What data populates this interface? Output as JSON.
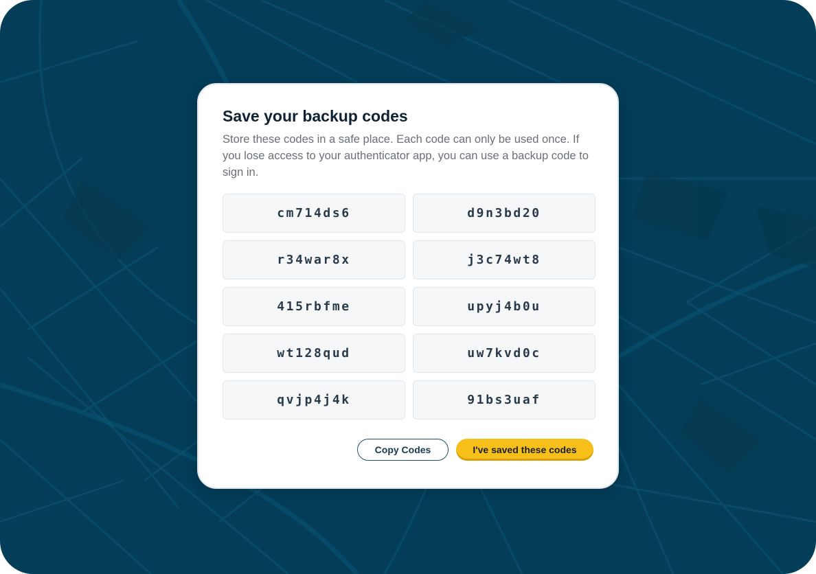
{
  "theme": {
    "background": "#033d58",
    "map_line_color": "#0a4f6e",
    "accent_yellow": "#f6bf1a",
    "button_outline": "#1d4e6b"
  },
  "dialog": {
    "title": "Save your backup codes",
    "description": "Store these codes in a safe place. Each code can only be used once. If you lose access to your authenticator app, you can use a backup code to sign in.",
    "codes": [
      "cm714ds6",
      "d9n3bd20",
      "r34war8x",
      "j3c74wt8",
      "415rbfme",
      "upyj4b0u",
      "wt128qud",
      "uw7kvd0c",
      "qvjp4j4k",
      "91bs3uaf"
    ],
    "buttons": {
      "copy_label": "Copy Codes",
      "confirm_label": "I've saved these codes"
    }
  }
}
